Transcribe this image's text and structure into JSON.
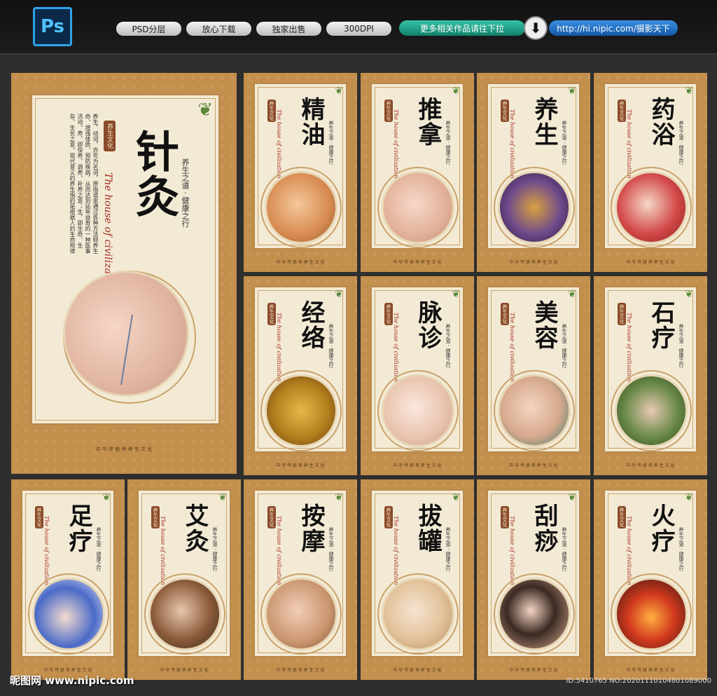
{
  "toolbar": {
    "ps_logo": "Ps",
    "pills": [
      "PSD分层",
      "放心下载",
      "独家出售",
      "300DPI"
    ],
    "more_label": "更多相关作品请往下拉",
    "arrow": "⬇",
    "url_label": "http://hi.nipic.com/摄影天下"
  },
  "main_poster": {
    "title": "针灸",
    "seal": "养生文化",
    "english": "The house of civilization",
    "slogan": "养生之道 · 健康之行",
    "body": "养生，动词，亦可为名词，原指道家通过各种方法颐养生命、增强体质、预防疾病，从而达到延年益寿的一种医事活动。养，即保养、调养、补养之意；生，即生命、生存、生长之意。现代意义的养生指的是根据人的生命规律",
    "footer": "中 华 传 统   养   养 生 文 化"
  },
  "posters": [
    {
      "title": "精油"
    },
    {
      "title": "推拿"
    },
    {
      "title": "养生"
    },
    {
      "title": "药浴"
    },
    {
      "title": "经络"
    },
    {
      "title": "脉诊"
    },
    {
      "title": "美容"
    },
    {
      "title": "石疗"
    },
    {
      "title": "足疗"
    },
    {
      "title": "艾灸"
    },
    {
      "title": "按摩"
    },
    {
      "title": "拔罐"
    },
    {
      "title": "刮痧"
    },
    {
      "title": "火疗"
    }
  ],
  "small_poster_text": {
    "seal": "养生文化",
    "english": "The house of civilization",
    "slogan": "养生之道 · 健康之行",
    "footer": "中 华 传 统  养  养 生 文 化"
  },
  "watermark": {
    "left": "昵图网 www.nipic.com",
    "right": "ID:5410765 NO:20201110104801089000"
  },
  "colors": {
    "board": "#c38f4c",
    "panel": "#f3ead5",
    "accent_red": "#a5281e"
  }
}
